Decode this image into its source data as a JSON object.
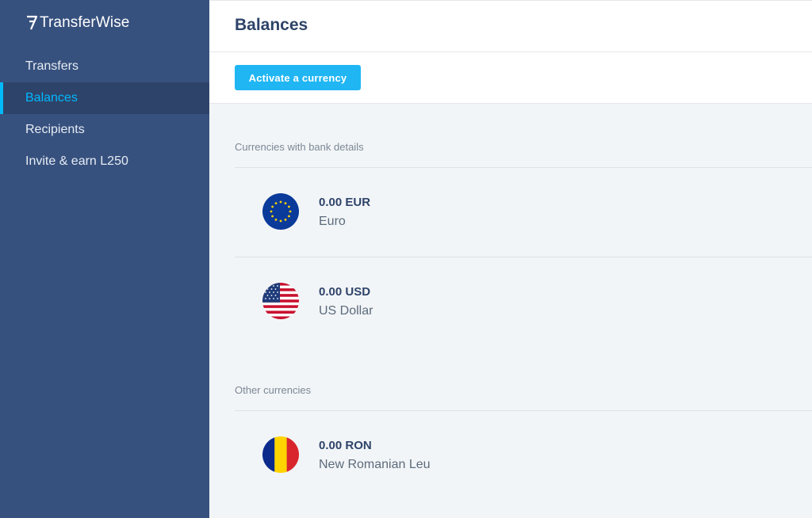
{
  "brand": {
    "name": "TransferWise"
  },
  "sidebar": {
    "items": [
      {
        "label": "Transfers",
        "active": false
      },
      {
        "label": "Balances",
        "active": true
      },
      {
        "label": "Recipients",
        "active": false
      },
      {
        "label": "Invite & earn L250",
        "active": false
      }
    ]
  },
  "header": {
    "title": "Balances"
  },
  "toolbar": {
    "activate_label": "Activate a currency"
  },
  "sections": [
    {
      "heading": "Currencies with bank details",
      "currencies": [
        {
          "amount": "0.00 EUR",
          "name": "Euro",
          "icon": "eu-flag-icon"
        },
        {
          "amount": "0.00 USD",
          "name": "US Dollar",
          "icon": "us-flag-icon"
        }
      ]
    },
    {
      "heading": "Other currencies",
      "currencies": [
        {
          "amount": "0.00 RON",
          "name": "New Romanian Leu",
          "icon": "romania-flag-icon"
        }
      ]
    }
  ],
  "colors": {
    "sidebar_bg": "#37517e",
    "accent": "#00b9ff",
    "button": "#1fb6f3",
    "title": "#2e4369"
  }
}
